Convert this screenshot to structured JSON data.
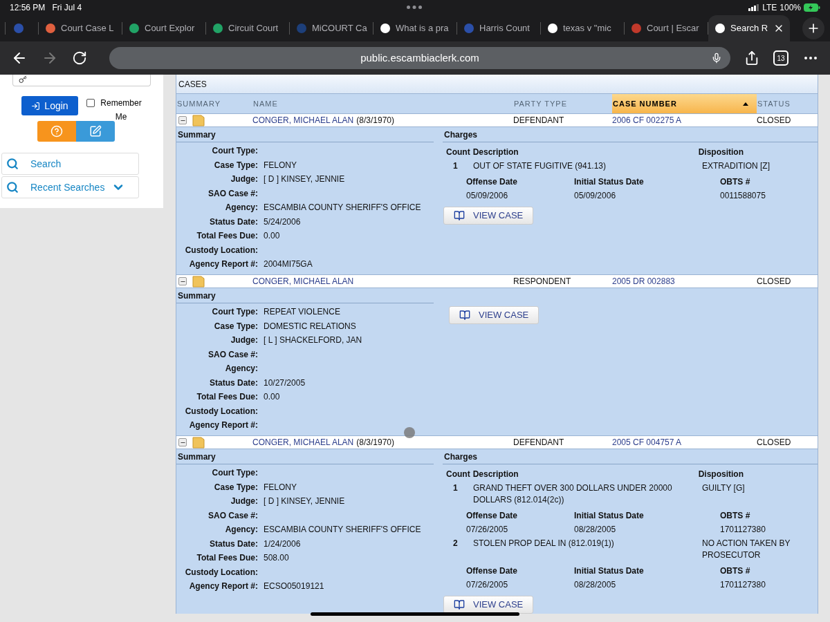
{
  "status_bar": {
    "time": "12:56 PM",
    "date": "Fri Jul 4",
    "network": "LTE",
    "battery": "100%"
  },
  "tabs": [
    {
      "selected": false
    },
    {
      "label": "Court Case L",
      "selected": false
    },
    {
      "label": "Court Explor",
      "selected": false
    },
    {
      "label": "Circuit Court",
      "selected": false
    },
    {
      "label": "MiCOURT Ca",
      "selected": false
    },
    {
      "label": "What is a pra",
      "selected": false
    },
    {
      "label": "Harris Count",
      "selected": false
    },
    {
      "label": "texas v \"mic",
      "selected": false
    },
    {
      "label": "Court | Escar",
      "selected": false
    },
    {
      "label": "Search R",
      "selected": true
    }
  ],
  "address_bar": {
    "url": "public.escambiaclerk.com",
    "tab_count": "13"
  },
  "sidebar": {
    "login": "Login",
    "remember": {
      "label": "Remember Me",
      "checked": false
    },
    "items": [
      {
        "label": "Search",
        "kind": "link"
      },
      {
        "label": "Recent Searches",
        "kind": "dropdown"
      }
    ]
  },
  "cases_panel": {
    "title": "CASES",
    "columns": [
      {
        "label": "SUMMARY",
        "selected": false
      },
      {
        "label": "NAME",
        "selected": false
      },
      {
        "label": "PARTY TYPE",
        "selected": false
      },
      {
        "label": "CASE NUMBER",
        "selected": true
      },
      {
        "label": "STATUS",
        "selected": false
      }
    ],
    "cases": [
      {
        "expanded": true,
        "name": "CONGER, MICHAEL ALAN",
        "dob": "(8/3/1970)",
        "party_type": "DEFENDANT",
        "case_number": "2006 CF 002275 A",
        "status": "CLOSED",
        "summary_title": "Summary",
        "fields": [
          {
            "label": "Court Type:"
          },
          {
            "label": "Case Type:",
            "value": "FELONY"
          },
          {
            "label": "Judge:",
            "value": "[ D ] KINSEY, JENNIE"
          },
          {
            "label": "SAO Case #:"
          },
          {
            "label": "Agency:",
            "value": "ESCAMBIA COUNTY SHERIFF'S OFFICE"
          },
          {
            "label": "Status Date:",
            "value": "5/24/2006"
          },
          {
            "label": "Total Fees Due:",
            "value": "0.00"
          },
          {
            "label": "Custody Location:"
          },
          {
            "label": "Agency Report #:",
            "value": "2004MI75GA"
          }
        ],
        "charges_title": "Charges",
        "charge_columns": [
          "Count",
          "Description",
          "Disposition"
        ],
        "charges": [
          {
            "count": "1",
            "description": "OUT OF STATE FUGITIVE (941.13)",
            "disposition": "EXTRADITION [Z]",
            "date_labels": [
              "Offense Date",
              "Initial Status Date",
              "OBTS #"
            ],
            "offense_date": "05/09/2006",
            "initial_status_date": "05/09/2006",
            "obts": "0011588075"
          }
        ],
        "view_case": "VIEW CASE"
      },
      {
        "expanded": true,
        "name": "CONGER, MICHAEL ALAN",
        "party_type": "RESPONDENT",
        "case_number": "2005 DR 002883",
        "status": "CLOSED",
        "summary_title": "Summary",
        "fields": [
          {
            "label": "Court Type:",
            "value": "REPEAT VIOLENCE"
          },
          {
            "label": "Case Type:",
            "value": "DOMESTIC RELATIONS"
          },
          {
            "label": "Judge:",
            "value": "[ L ] SHACKELFORD, JAN"
          },
          {
            "label": "SAO Case #:"
          },
          {
            "label": "Agency:"
          },
          {
            "label": "Status Date:",
            "value": "10/27/2005"
          },
          {
            "label": "Total Fees Due:",
            "value": "0.00"
          },
          {
            "label": "Custody Location:"
          },
          {
            "label": "Agency Report #:"
          }
        ],
        "view_case": "VIEW CASE"
      },
      {
        "expanded": true,
        "name": "CONGER, MICHAEL ALAN",
        "dob": "(8/3/1970)",
        "party_type": "DEFENDANT",
        "case_number": "2005 CF 004757 A",
        "status": "CLOSED",
        "summary_title": "Summary",
        "fields": [
          {
            "label": "Court Type:"
          },
          {
            "label": "Case Type:",
            "value": "FELONY"
          },
          {
            "label": "Judge:",
            "value": "[ D ] KINSEY, JENNIE"
          },
          {
            "label": "SAO Case #:"
          },
          {
            "label": "Agency:",
            "value": "ESCAMBIA COUNTY SHERIFF'S OFFICE"
          },
          {
            "label": "Status Date:",
            "value": "1/24/2006"
          },
          {
            "label": "Total Fees Due:",
            "value": "508.00"
          },
          {
            "label": "Custody Location:"
          },
          {
            "label": "Agency Report #:",
            "value": "ECSO05019121"
          }
        ],
        "charges_title": "Charges",
        "charge_columns": [
          "Count",
          "Description",
          "Disposition"
        ],
        "charges": [
          {
            "count": "1",
            "description": "GRAND THEFT OVER 300 DOLLARS UNDER 20000 DOLLARS (812.014(2c))",
            "disposition": "GUILTY [G]",
            "date_labels": [
              "Offense Date",
              "Initial Status Date",
              "OBTS #"
            ],
            "offense_date": "07/26/2005",
            "initial_status_date": "08/28/2005",
            "obts": "1701127380"
          },
          {
            "count": "2",
            "description": "STOLEN PROP DEAL IN (812.019(1))",
            "disposition": "NO ACTION TAKEN BY PROSECUTOR",
            "date_labels": [
              "Offense Date",
              "Initial Status Date",
              "OBTS #"
            ],
            "offense_date": "07/26/2005",
            "initial_status_date": "08/28/2005",
            "obts": "1701127380"
          }
        ],
        "view_case": "VIEW CASE"
      }
    ]
  }
}
